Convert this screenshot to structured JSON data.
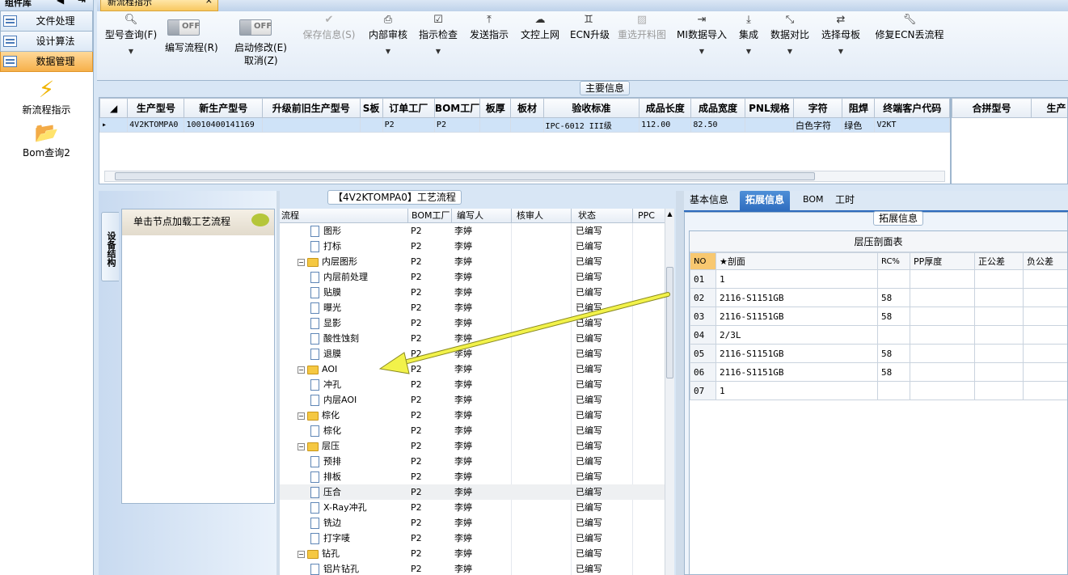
{
  "sidebar": {
    "header": "组件库",
    "items": [
      {
        "label": "文件处理"
      },
      {
        "label": "设计算法"
      },
      {
        "label": "数据管理"
      }
    ],
    "tools": [
      {
        "label": "新流程指示",
        "icon": "lightning-icon"
      },
      {
        "label": "Bom查询2",
        "icon": "folder-open-icon"
      }
    ]
  },
  "doc_tab": {
    "label": "新流程指示"
  },
  "toolbar": {
    "model_query": "型号查询(F)",
    "write_flow_toggle": "OFF",
    "write_flow": "编写流程(R)",
    "start_edit_toggle": "OFF",
    "start_edit": "启动修改(E)",
    "cancel": "取消(Z)",
    "save_info": "保存信息(S)",
    "internal_review": "内部审核",
    "instruction_check": "指示检查",
    "send_instruction": "发送指示",
    "doc_upload": "文控上网",
    "ecn_upgrade": "ECN升级",
    "reselect_cutting": "重选开料图",
    "mi_import": "MI数据导入",
    "integrate": "集成",
    "data_compare": "数据对比",
    "select_master": "选择母板",
    "repair_ecn": "修复ECN丢流程"
  },
  "main_info": {
    "caption": "主要信息",
    "columns": [
      "生产型号",
      "新生产型号",
      "升级前旧生产型号",
      "S板",
      "订单工厂",
      "BOM工厂",
      "板厚",
      "板材",
      "验收标准",
      "成品长度",
      "成品宽度",
      "PNL规格",
      "字符",
      "阻焊",
      "终端客户代码"
    ],
    "rows": [
      [
        "4V2KTOMPA0",
        "10010400141169",
        "",
        "",
        "P2",
        "P2",
        "",
        "",
        "IPC-6012 III级",
        "112.00",
        "82.50",
        "",
        "白色字符",
        "绿色",
        "V2KT"
      ]
    ],
    "side_columns": [
      "合拼型号",
      "生产"
    ]
  },
  "equipment_panel": {
    "vtab": "设备结构",
    "button": "单击节点加载工艺流程"
  },
  "process_flow": {
    "caption": "【4V2KTOMPA0】工艺流程",
    "columns": [
      "流程",
      "BOM工厂",
      "编写人",
      "核审人",
      "状态",
      "PPC"
    ],
    "rows": [
      {
        "name": "图形",
        "level": 2,
        "folder": false,
        "bom": "P2",
        "writer": "李婷",
        "status": "已编写"
      },
      {
        "name": "打标",
        "level": 2,
        "folder": false,
        "bom": "P2",
        "writer": "李婷",
        "status": "已编写"
      },
      {
        "name": "内层图形",
        "level": 1,
        "folder": true,
        "bom": "P2",
        "writer": "李婷",
        "status": "已编写"
      },
      {
        "name": "内层前处理",
        "level": 2,
        "folder": false,
        "bom": "P2",
        "writer": "李婷",
        "status": "已编写"
      },
      {
        "name": "贴膜",
        "level": 2,
        "folder": false,
        "bom": "P2",
        "writer": "李婷",
        "status": "已编写"
      },
      {
        "name": "曝光",
        "level": 2,
        "folder": false,
        "bom": "P2",
        "writer": "李婷",
        "status": "已编写"
      },
      {
        "name": "显影",
        "level": 2,
        "folder": false,
        "bom": "P2",
        "writer": "李婷",
        "status": "已编写"
      },
      {
        "name": "酸性蚀刻",
        "level": 2,
        "folder": false,
        "bom": "P2",
        "writer": "李婷",
        "status": "已编写"
      },
      {
        "name": "退膜",
        "level": 2,
        "folder": false,
        "bom": "P2",
        "writer": "李婷",
        "status": "已编写"
      },
      {
        "name": "AOI",
        "level": 1,
        "folder": true,
        "bom": "P2",
        "writer": "李婷",
        "status": "已编写"
      },
      {
        "name": "冲孔",
        "level": 2,
        "folder": false,
        "bom": "P2",
        "writer": "李婷",
        "status": "已编写"
      },
      {
        "name": "内层AOI",
        "level": 2,
        "folder": false,
        "bom": "P2",
        "writer": "李婷",
        "status": "已编写"
      },
      {
        "name": "棕化",
        "level": 1,
        "folder": true,
        "bom": "P2",
        "writer": "李婷",
        "status": "已编写"
      },
      {
        "name": "棕化",
        "level": 2,
        "folder": false,
        "bom": "P2",
        "writer": "李婷",
        "status": "已编写"
      },
      {
        "name": "层压",
        "level": 1,
        "folder": true,
        "bom": "P2",
        "writer": "李婷",
        "status": "已编写"
      },
      {
        "name": "预排",
        "level": 2,
        "folder": false,
        "bom": "P2",
        "writer": "李婷",
        "status": "已编写"
      },
      {
        "name": "排板",
        "level": 2,
        "folder": false,
        "bom": "P2",
        "writer": "李婷",
        "status": "已编写"
      },
      {
        "name": "压合",
        "level": 2,
        "folder": false,
        "bom": "P2",
        "writer": "李婷",
        "status": "已编写",
        "selected": true
      },
      {
        "name": "X-Ray冲孔",
        "level": 2,
        "folder": false,
        "bom": "P2",
        "writer": "李婷",
        "status": "已编写"
      },
      {
        "name": "铣边",
        "level": 2,
        "folder": false,
        "bom": "P2",
        "writer": "李婷",
        "status": "已编写"
      },
      {
        "name": "打字唛",
        "level": 2,
        "folder": false,
        "bom": "P2",
        "writer": "李婷",
        "status": "已编写"
      },
      {
        "name": "钻孔",
        "level": 1,
        "folder": true,
        "bom": "P2",
        "writer": "李婷",
        "status": "已编写"
      },
      {
        "name": "铝片钻孔",
        "level": 2,
        "folder": false,
        "bom": "P2",
        "writer": "李婷",
        "status": "已编写"
      }
    ]
  },
  "right_panel": {
    "tabs": [
      "基本信息",
      "拓展信息",
      "BOM",
      "工时"
    ],
    "active_tab": 1,
    "caption": "拓展信息",
    "table_title": "层压剖面表",
    "columns": [
      "NO",
      "★剖面",
      "RC%",
      "PP厚度",
      "正公差",
      "负公差"
    ],
    "rows": [
      [
        "01",
        "1",
        "",
        "",
        "",
        ""
      ],
      [
        "02",
        "2116-S1151GB",
        "58",
        "",
        "",
        ""
      ],
      [
        "03",
        "2116-S1151GB",
        "58",
        "",
        "",
        ""
      ],
      [
        "04",
        "2/3L",
        "",
        "",
        "",
        ""
      ],
      [
        "05",
        "2116-S1151GB",
        "58",
        "",
        "",
        ""
      ],
      [
        "06",
        "2116-S1151GB",
        "58",
        "",
        "",
        ""
      ],
      [
        "07",
        "1",
        "",
        "",
        "",
        ""
      ]
    ]
  },
  "colors": {
    "accent": "#2d6bbd",
    "active_item": "#f6b04a",
    "arrow": "#f2f24a"
  }
}
